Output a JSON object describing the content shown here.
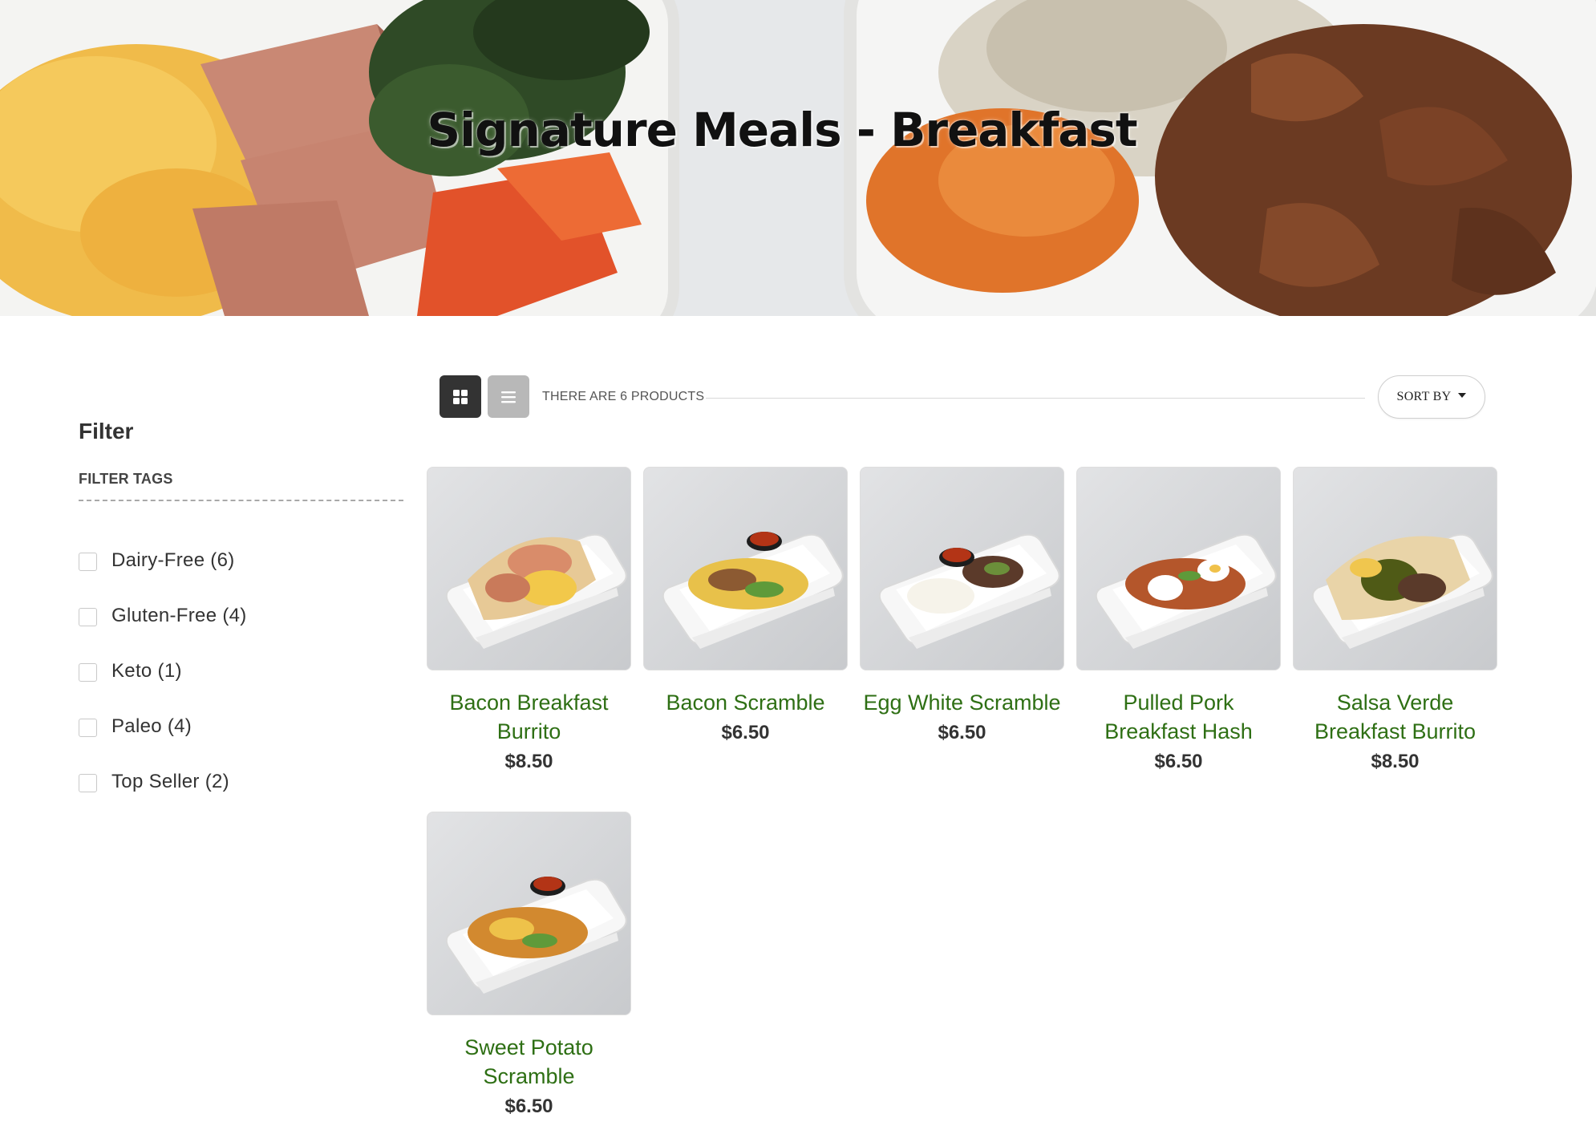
{
  "hero": {
    "title": "Signature Meals - Breakfast"
  },
  "sidebar": {
    "heading": "Filter",
    "tags_label": "FILTER TAGS",
    "filters": [
      {
        "label": "Dairy-Free (6)",
        "checked": false
      },
      {
        "label": "Gluten-Free (4)",
        "checked": false
      },
      {
        "label": "Keto (1)",
        "checked": false
      },
      {
        "label": "Paleo (4)",
        "checked": false
      },
      {
        "label": "Top Seller (2)",
        "checked": false
      }
    ]
  },
  "toolbar": {
    "grid_view_icon": "grid-icon",
    "list_view_icon": "list-icon",
    "active_view": "grid",
    "product_count": "THERE ARE 6 PRODUCTS",
    "sort_label": "SORT BY"
  },
  "products": [
    {
      "name": "Bacon Breakfast Burrito",
      "price": "$8.50",
      "image": "burrito"
    },
    {
      "name": "Bacon Scramble",
      "price": "$6.50",
      "image": "scramble-salsa"
    },
    {
      "name": "Egg White Scramble",
      "price": "$6.50",
      "image": "egg-white"
    },
    {
      "name": "Pulled Pork Breakfast Hash",
      "price": "$6.50",
      "image": "hash"
    },
    {
      "name": "Salsa Verde Breakfast Burrito",
      "price": "$8.50",
      "image": "burrito-verde"
    },
    {
      "name": "Sweet Potato Scramble",
      "price": "$6.50",
      "image": "scramble-salsa"
    }
  ],
  "colors": {
    "link_green": "#2e6f14",
    "active_view_bg": "#333333",
    "inactive_view_bg": "#b8b8b8"
  }
}
